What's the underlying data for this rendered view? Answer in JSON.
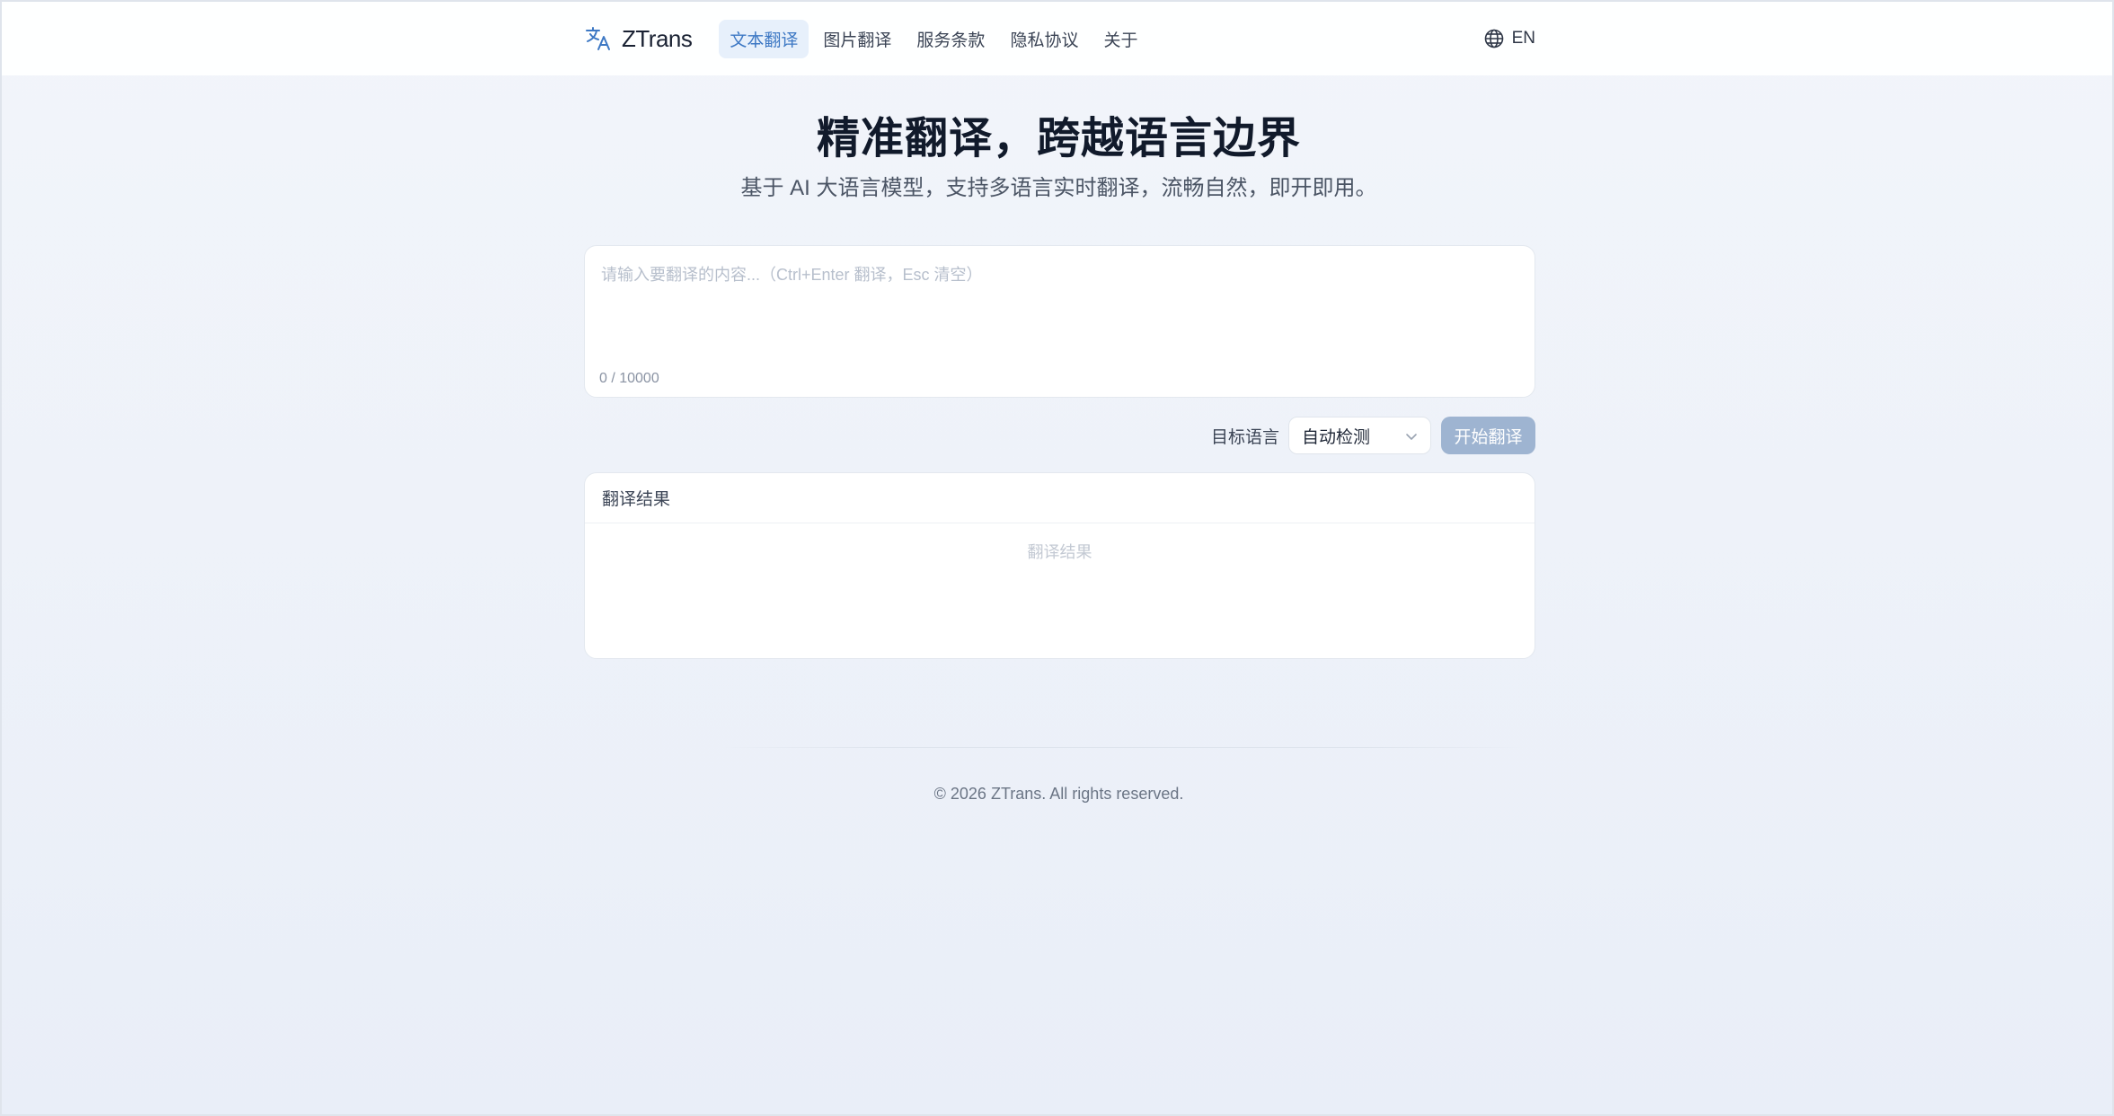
{
  "header": {
    "logo_text": "ZTrans",
    "nav": [
      {
        "label": "文本翻译",
        "active": true
      },
      {
        "label": "图片翻译",
        "active": false
      },
      {
        "label": "服务条款",
        "active": false
      },
      {
        "label": "隐私协议",
        "active": false
      },
      {
        "label": "关于",
        "active": false
      }
    ],
    "language": "EN"
  },
  "hero": {
    "title": "精准翻译，跨越语言边界",
    "subtitle": "基于 AI 大语言模型，支持多语言实时翻译，流畅自然，即开即用。"
  },
  "input": {
    "value": "",
    "placeholder": "请输入要翻译的内容...（Ctrl+Enter 翻译，Esc 清空）",
    "char_count": "0 / 10000"
  },
  "controls": {
    "target_label": "目标语言",
    "target_value": "自动检测",
    "translate_button": "开始翻译"
  },
  "result": {
    "header": "翻译结果",
    "placeholder": "翻译结果"
  },
  "footer": {
    "copyright": "© 2026 ZTrans. All rights reserved."
  },
  "colors": {
    "accent": "#3d78c4",
    "nav_active_bg": "#e7f0fb",
    "button_disabled": "#9eb4d1"
  }
}
